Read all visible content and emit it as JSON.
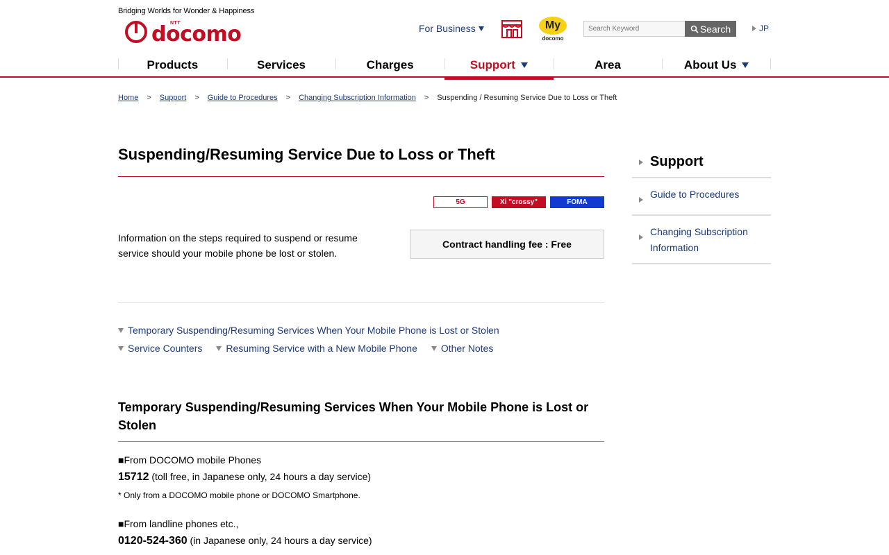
{
  "header": {
    "tagline": "Bridging Worlds for Wonder & Happiness",
    "logo_text": "docomo",
    "logo_ntt": "NTT",
    "for_business": "For Business",
    "my_docomo": {
      "badge": "My",
      "sub": "docomo"
    },
    "search": {
      "placeholder": "Search Keyword",
      "button": "Search"
    },
    "lang": "JP",
    "brand_color": "#c30d23",
    "link_color": "#1a3a7c"
  },
  "nav": {
    "items": [
      {
        "label": "Products"
      },
      {
        "label": "Services"
      },
      {
        "label": "Charges"
      },
      {
        "label": "Support",
        "active": true
      },
      {
        "label": "Area"
      },
      {
        "label": "About Us"
      }
    ]
  },
  "breadcrumb": {
    "items": [
      "Home",
      "Support",
      "Guide to Procedures",
      "Changing Subscription Information"
    ],
    "current": "Suspending / Resuming Service Due to Loss or Theft",
    "separator": ">"
  },
  "main": {
    "title": "Suspending/Resuming Service Due to Loss or Theft",
    "badges": [
      "5G",
      "Xi \"crossy\"",
      "FOMA"
    ],
    "intro": "Information on the steps required to suspend or resume service should your mobile phone be lost or stolen.",
    "fee": "Contract handling fee : Free",
    "anchors": [
      "Temporary Suspending/Resuming Services When Your Mobile Phone is Lost or Stolen",
      "Service Counters",
      "Resuming Service with a New Mobile Phone",
      "Other Notes"
    ],
    "section_title": "Temporary Suspending/Resuming Services When Your Mobile Phone is Lost or Stolen",
    "contacts": [
      {
        "label": "■From DOCOMO mobile Phones",
        "number": "15712",
        "detail": " (toll free, in Japanese only, 24 hours a day service)",
        "note": "* Only from a DOCOMO mobile phone or DOCOMO Smartphone."
      },
      {
        "label": "■From landline phones etc.,",
        "number": "0120-524-360",
        "detail": " (in Japanese only, 24 hours a day service)"
      }
    ]
  },
  "sidebar": {
    "heading": "Support",
    "items": [
      "Guide to Procedures",
      "Changing Subscription Information"
    ]
  }
}
